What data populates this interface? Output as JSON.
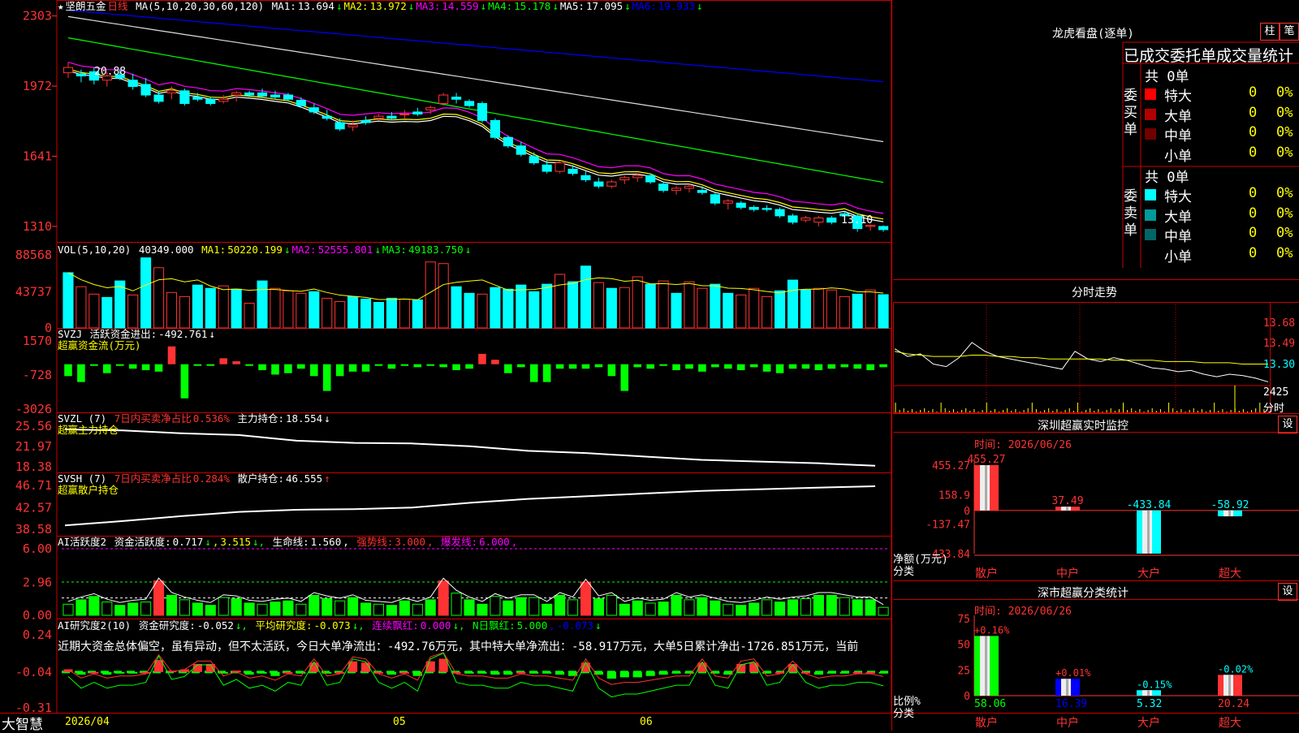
{
  "stock_name": "坚朗五金",
  "period": "日线",
  "app_name": "大智慧",
  "price_header": {
    "params": "MA(5,10,20,30,60,120)",
    "items": [
      {
        "label": "MA1:",
        "value": "13.694",
        "arrow": "↓",
        "color": "#ffffff"
      },
      {
        "label": "MA2:",
        "value": "13.972",
        "arrow": "↓",
        "color": "#ffff00"
      },
      {
        "label": "MA3:",
        "value": "14.559",
        "arrow": "↓",
        "color": "#ff00ff"
      },
      {
        "label": "MA4:",
        "value": "15.178",
        "arrow": "↓",
        "color": "#00ff00"
      },
      {
        "label": "MA5:",
        "value": "17.095",
        "arrow": "↓",
        "color": "#ffffff"
      },
      {
        "label": "MA6:",
        "value": "19.933",
        "arrow": "↓",
        "color": "#0000ff"
      }
    ]
  },
  "vol_header": {
    "params": "VOL(5,10,20)",
    "value": "40349.000",
    "items": [
      {
        "label": "MA1:",
        "value": "50220.199",
        "arrow": "↓",
        "color": "#ffff00"
      },
      {
        "label": "MA2:",
        "value": "52555.801",
        "arrow": "↓",
        "color": "#ff00ff"
      },
      {
        "label": "MA3:",
        "value": "49183.750",
        "arrow": "↓",
        "color": "#00ff00"
      }
    ]
  },
  "svzj_header": {
    "name": "SVZJ",
    "label": "活跃资金进出:",
    "value": "-492.761",
    "arrow": "↓",
    "sub": "超赢资金流(万元)"
  },
  "svzl_header": {
    "name": "SVZL (7)",
    "label1": "7日内买卖净占比",
    "value1": "0.536%",
    "label2": "主力持仓:",
    "value2": "18.554",
    "arrow": "↓",
    "sub": "超赢主力持仓"
  },
  "svsh_header": {
    "name": "SVSH (7)",
    "label1": "7日内买卖净占比",
    "value1": "0.284%",
    "label2": "散户持仓:",
    "value2": "46.555",
    "arrow": "↑",
    "sub": "超赢散户持仓"
  },
  "ai1_header": {
    "name": "AI活跃度2",
    "label": "资金活跃度:",
    "value": "0.717",
    "arrow": "↓",
    "value2": "3.515",
    "life_label": "生命线:",
    "life": "1.560",
    "strong_label": "强势线:",
    "strong": "3.000",
    "burst_label": "爆发线:",
    "burst": "6.000"
  },
  "ai2_header": {
    "name": "AI研究度2(10)",
    "label": "资金研究度:",
    "value": "-0.052",
    "label2": "平均研究度:",
    "value2": "-0.073",
    "label3": "连续飘红:",
    "value3": "0.000",
    "label4": "N日飘红:",
    "value4": "5.000",
    "value5": "-0.073"
  },
  "narrative": "近期大资金总体偏空，虽有异动，但不太活跃，今日大单净流出：-492.76万元，其中特大单净流出：-58.917万元，大单5日累计净出-1726.851万元，当前",
  "date_labels": [
    "2026/04",
    "05",
    "06"
  ],
  "right_panel": {
    "lhb_title": "龙虎看盘(逐单)",
    "btn_zhu": "柱",
    "btn_bi": "笔",
    "stats_title": "已成交委托单成交量统计",
    "buy_side": "委买单",
    "sell_side": "委卖单",
    "buy_total": "共 0单",
    "sell_total": "共 0单",
    "buy_rows": [
      {
        "label": "特大",
        "count": "0",
        "pct": "0%",
        "color": "#ff0000"
      },
      {
        "label": "大单",
        "count": "0",
        "pct": "0%",
        "color": "#b00000"
      },
      {
        "label": "中单",
        "count": "0",
        "pct": "0%",
        "color": "#700000"
      },
      {
        "label": "小单",
        "count": "0",
        "pct": "0%",
        "color": "#000000"
      }
    ],
    "sell_rows": [
      {
        "label": "特大",
        "count": "0",
        "pct": "0%",
        "color": "#00ffff"
      },
      {
        "label": "大单",
        "count": "0",
        "pct": "0%",
        "color": "#009999"
      },
      {
        "label": "中单",
        "count": "0",
        "pct": "0%",
        "color": "#006666"
      },
      {
        "label": "小单",
        "count": "0",
        "pct": "0%",
        "color": "#000000"
      }
    ],
    "intraday_title": "分时走势",
    "intraday_axis": [
      "13.68",
      "13.49",
      "13.30",
      "2425",
      "分时"
    ],
    "sz_monitor_title": "深圳超赢实时监控",
    "sz_class_title": "深市超赢分类统计",
    "btn_set": "设",
    "date_label": "时间: 2026/06/26",
    "net_label1": "净额(万元)",
    "net_label2": "分类",
    "ratio_label1": "比例%",
    "ratio_label2": "分类",
    "categories": [
      "散户",
      "中户",
      "大户",
      "超大"
    ]
  },
  "chart_data": [
    {
      "type": "candlestick",
      "title": "坚朗五金 日线",
      "y_ticks": [
        "2303",
        "1972",
        "1641",
        "1310"
      ],
      "price_tick_values": [
        23.03,
        19.72,
        16.41,
        13.1
      ],
      "ylim": [
        12.6,
        23.4
      ],
      "annotations": [
        {
          "text": "20.88"
        },
        {
          "text": "13.10"
        }
      ],
      "ohlc": [
        [
          20.35,
          20.85,
          20.1,
          20.6
        ],
        [
          20.3,
          20.5,
          19.9,
          20.2
        ],
        [
          20.4,
          20.6,
          19.8,
          20.0
        ],
        [
          20.0,
          20.4,
          19.7,
          20.2
        ],
        [
          20.25,
          20.5,
          20.0,
          20.1
        ],
        [
          20.0,
          20.3,
          19.55,
          19.7
        ],
        [
          19.8,
          20.1,
          19.2,
          19.3
        ],
        [
          19.3,
          19.5,
          18.9,
          19.0
        ],
        [
          19.4,
          19.7,
          19.1,
          19.5
        ],
        [
          19.5,
          19.6,
          18.8,
          18.9
        ],
        [
          19.2,
          19.4,
          19.0,
          19.1
        ],
        [
          19.1,
          19.2,
          18.8,
          18.9
        ],
        [
          19.0,
          19.3,
          18.9,
          19.1
        ],
        [
          19.3,
          19.5,
          19.0,
          19.4
        ],
        [
          19.4,
          19.5,
          19.2,
          19.3
        ],
        [
          19.4,
          19.6,
          19.2,
          19.25
        ],
        [
          19.3,
          19.5,
          19.1,
          19.2
        ],
        [
          19.3,
          19.4,
          19.0,
          19.1
        ],
        [
          19.05,
          19.2,
          18.7,
          18.8
        ],
        [
          18.7,
          18.9,
          18.4,
          18.5
        ],
        [
          18.3,
          18.6,
          18.1,
          18.2
        ],
        [
          18.0,
          18.2,
          17.6,
          17.7
        ],
        [
          17.8,
          18.1,
          17.6,
          17.9
        ],
        [
          18.1,
          18.3,
          17.9,
          18.0
        ],
        [
          18.2,
          18.4,
          18.1,
          18.3
        ],
        [
          18.3,
          18.5,
          18.1,
          18.2
        ],
        [
          18.4,
          18.6,
          18.2,
          18.4
        ],
        [
          18.5,
          18.7,
          18.3,
          18.4
        ],
        [
          18.6,
          18.8,
          18.4,
          18.7
        ],
        [
          18.9,
          19.4,
          18.8,
          19.3
        ],
        [
          19.2,
          19.4,
          18.9,
          19.1
        ],
        [
          19.0,
          19.1,
          18.7,
          18.8
        ],
        [
          18.9,
          19.0,
          18.0,
          18.1
        ],
        [
          18.1,
          18.2,
          17.2,
          17.3
        ],
        [
          17.3,
          17.4,
          16.8,
          16.9
        ],
        [
          16.9,
          17.1,
          16.4,
          16.5
        ],
        [
          16.4,
          16.6,
          16.0,
          16.1
        ],
        [
          16.0,
          16.2,
          15.6,
          15.7
        ],
        [
          15.7,
          16.2,
          15.6,
          16.1
        ],
        [
          15.8,
          16.0,
          15.5,
          15.6
        ],
        [
          15.5,
          15.7,
          15.2,
          15.3
        ],
        [
          15.2,
          15.4,
          14.9,
          15.0
        ],
        [
          15.0,
          15.3,
          14.9,
          15.2
        ],
        [
          15.3,
          15.5,
          15.1,
          15.4
        ],
        [
          15.4,
          15.6,
          15.2,
          15.5
        ],
        [
          15.5,
          15.6,
          15.1,
          15.2
        ],
        [
          15.1,
          15.2,
          14.7,
          14.8
        ],
        [
          14.8,
          15.0,
          14.6,
          14.9
        ],
        [
          14.9,
          15.1,
          14.7,
          15.0
        ],
        [
          14.8,
          15.0,
          14.6,
          14.7
        ],
        [
          14.6,
          14.7,
          14.1,
          14.2
        ],
        [
          14.2,
          14.4,
          13.9,
          14.3
        ],
        [
          14.2,
          14.3,
          13.9,
          14.0
        ],
        [
          14.0,
          14.1,
          13.8,
          13.9
        ],
        [
          13.95,
          14.1,
          13.8,
          13.9
        ],
        [
          13.9,
          14.0,
          13.5,
          13.6
        ],
        [
          13.6,
          13.7,
          13.2,
          13.3
        ],
        [
          13.4,
          13.6,
          13.3,
          13.5
        ],
        [
          13.3,
          13.6,
          13.1,
          13.5
        ],
        [
          13.5,
          13.6,
          13.2,
          13.3
        ],
        [
          13.7,
          13.8,
          13.5,
          13.6
        ],
        [
          13.6,
          13.7,
          12.85,
          13.0
        ],
        [
          13.1,
          13.2,
          12.9,
          13.15
        ],
        [
          13.1,
          13.15,
          12.85,
          12.95
        ]
      ],
      "ma_series": [
        {
          "name": "MA1",
          "start": 20.4,
          "end": 13.69,
          "color": "#ffffff"
        },
        {
          "name": "MA2",
          "start": 20.6,
          "end": 13.97,
          "color": "#ffff00"
        },
        {
          "name": "MA3",
          "start": 21.3,
          "end": 14.56,
          "color": "#ff00ff"
        },
        {
          "name": "MA4",
          "start": 22.0,
          "end": 15.18,
          "color": "#00ff00"
        },
        {
          "name": "MA5",
          "start": 23.0,
          "end": 17.1,
          "color": "#dddddd"
        },
        {
          "name": "MA6",
          "start": 23.3,
          "end": 19.93,
          "color": "#0000ff"
        }
      ]
    },
    {
      "type": "bar",
      "title": "VOL",
      "y_ticks": [
        "88568",
        "43737",
        "0"
      ],
      "ylim": [
        0,
        88568
      ],
      "values": [
        67000,
        50000,
        41000,
        37000,
        57000,
        40000,
        85000,
        73000,
        43000,
        38000,
        52000,
        48000,
        51000,
        47000,
        30000,
        57000,
        48000,
        45000,
        42000,
        44000,
        36000,
        32000,
        38000,
        35000,
        31000,
        36000,
        35000,
        34000,
        80000,
        78000,
        50000,
        42000,
        41000,
        49000,
        47000,
        52000,
        44000,
        53000,
        65000,
        56000,
        75000,
        55000,
        48000,
        49000,
        62000,
        53000,
        57000,
        42000,
        56000,
        48000,
        53000,
        42000,
        40000,
        48000,
        38000,
        45000,
        58000,
        46000,
        48000,
        46000,
        38000,
        41000,
        46000,
        40349
      ],
      "up_down": [
        "d",
        "u",
        "u",
        "d",
        "d",
        "u",
        "d",
        "u",
        "u",
        "u",
        "d",
        "d",
        "u",
        "d",
        "u",
        "d",
        "u",
        "u",
        "u",
        "d",
        "u",
        "u",
        "d",
        "d",
        "d",
        "d",
        "u",
        "d",
        "u",
        "u",
        "d",
        "d",
        "u",
        "d",
        "d",
        "d",
        "d",
        "d",
        "u",
        "d",
        "d",
        "u",
        "d",
        "u",
        "u",
        "d",
        "u",
        "d",
        "u",
        "u",
        "d",
        "d",
        "u",
        "u",
        "u",
        "d",
        "d",
        "d",
        "u",
        "u",
        "u",
        "d",
        "u",
        "d"
      ]
    },
    {
      "type": "bar",
      "title": "SVZJ 超赢资金流(万元)",
      "y_ticks": [
        "1570",
        "-728",
        "-3026"
      ],
      "ylim": [
        -3026,
        1570
      ],
      "values": [
        -800,
        -1200,
        -50,
        -600,
        -100,
        -300,
        -400,
        -500,
        1200,
        -2300,
        -100,
        -100,
        400,
        200,
        -50,
        -400,
        -700,
        -600,
        -300,
        -800,
        -1800,
        -800,
        -500,
        -500,
        -100,
        -300,
        -100,
        -200,
        -100,
        -200,
        -400,
        -300,
        700,
        300,
        -600,
        -200,
        -1200,
        -1200,
        -300,
        -300,
        -300,
        -200,
        -800,
        -1800,
        -200,
        -300,
        -100,
        -400,
        -300,
        -500,
        -200,
        -300,
        -400,
        -200,
        -500,
        -600,
        -300,
        -300,
        -400,
        -300,
        -200,
        -300,
        -400,
        -200,
        -300,
        -500,
        -500,
        -492
      ]
    },
    {
      "type": "line",
      "title": "SVZL 超赢主力持仓",
      "y_ticks": [
        "25.56",
        "21.97",
        "18.38"
      ],
      "ylim": [
        18.38,
        25.56
      ],
      "values": [
        25.0,
        24.8,
        24.3,
        24.0,
        23.0,
        22.6,
        22.5,
        22.0,
        21.2,
        20.8,
        20.2,
        19.6,
        19.3,
        19.0,
        18.554
      ]
    },
    {
      "type": "line",
      "title": "SVSH 超赢散户持仓",
      "y_ticks": [
        "46.71",
        "42.57",
        "38.58"
      ],
      "ylim": [
        38.58,
        46.71
      ],
      "values": [
        39.3,
        40.1,
        41.0,
        41.8,
        42.2,
        42.3,
        42.6,
        43.5,
        44.2,
        44.7,
        45.2,
        45.7,
        46.0,
        46.3,
        46.555
      ]
    },
    {
      "type": "bar",
      "title": "AI活跃度2",
      "y_ticks": [
        "6.00",
        "2.96",
        "0.00"
      ],
      "ylim": [
        0,
        6.0
      ],
      "values": [
        1.0,
        1.4,
        1.7,
        1.2,
        0.9,
        1.1,
        1.2,
        3.1,
        1.8,
        1.4,
        1.1,
        0.9,
        1.6,
        1.5,
        1.1,
        1.0,
        1.2,
        1.3,
        1.0,
        1.8,
        1.5,
        1.3,
        1.6,
        1.1,
        1.0,
        0.9,
        1.3,
        1.0,
        1.4,
        3.1,
        2.0,
        1.4,
        1.0,
        1.7,
        1.3,
        1.6,
        1.6,
        1.0,
        1.8,
        1.4,
        3.0,
        1.5,
        1.8,
        1.0,
        1.3,
        1.1,
        1.2,
        1.8,
        1.4,
        1.6,
        1.3,
        1.0,
        0.9,
        1.1,
        1.4,
        1.2,
        1.4,
        1.5,
        1.8,
        1.8,
        1.6,
        1.4,
        1.4,
        0.717
      ],
      "reference_lines": [
        {
          "value": 3.0,
          "color": "#00ff00"
        },
        {
          "value": 6.0,
          "color": "#ff00ff"
        },
        {
          "value": 1.56,
          "color": "#ffffff"
        }
      ]
    },
    {
      "type": "bar",
      "title": "AI研究度2",
      "y_ticks": [
        "0.24",
        "-0.04",
        "-0.31"
      ],
      "ylim": [
        -0.31,
        0.24
      ],
      "values": [
        -0.02,
        -0.06,
        -0.04,
        -0.06,
        -0.05,
        -0.05,
        -0.04,
        0.05,
        -0.03,
        -0.02,
        0.02,
        0.02,
        -0.05,
        -0.03,
        -0.06,
        -0.05,
        -0.07,
        -0.04,
        -0.05,
        0.03,
        -0.05,
        -0.04,
        0.04,
        0.03,
        -0.04,
        -0.06,
        -0.04,
        -0.07,
        0.04,
        0.06,
        -0.04,
        -0.05,
        -0.05,
        -0.06,
        -0.06,
        -0.04,
        -0.05,
        -0.05,
        -0.06,
        -0.07,
        0.03,
        -0.06,
        -0.09,
        -0.08,
        -0.08,
        -0.07,
        -0.06,
        -0.05,
        -0.05,
        0.03,
        -0.05,
        -0.06,
        0.02,
        0.03,
        -0.05,
        -0.04,
        0.02,
        -0.04,
        -0.06,
        -0.05,
        -0.05,
        -0.04,
        -0.04,
        -0.052
      ]
    },
    {
      "type": "line",
      "title": "分时走势",
      "y_ticks": [
        "13.68",
        "13.49",
        "13.30"
      ],
      "ylim": [
        13.15,
        13.75
      ],
      "values": [
        13.42,
        13.36,
        13.38,
        13.3,
        13.28,
        13.35,
        13.47,
        13.4,
        13.36,
        13.34,
        13.32,
        13.3,
        13.28,
        13.26,
        13.4,
        13.34,
        13.32,
        13.35,
        13.33,
        13.3,
        13.27,
        13.26,
        13.24,
        13.25,
        13.22,
        13.2,
        13.22,
        13.21,
        13.19,
        13.16
      ],
      "avg": [
        13.4,
        13.38,
        13.37,
        13.36,
        13.36,
        13.36,
        13.37,
        13.37,
        13.36,
        13.36,
        13.35,
        13.35,
        13.34,
        13.34,
        13.34,
        13.34,
        13.34,
        13.33,
        13.33,
        13.33,
        13.33,
        13.32,
        13.32,
        13.32,
        13.31,
        13.31,
        13.31,
        13.3,
        13.3,
        13.3
      ]
    },
    {
      "type": "bar",
      "title": "深圳超赢实时监控",
      "categories": [
        "散户",
        "中户",
        "大户",
        "超大"
      ],
      "values": [
        455.27,
        37.49,
        -433.84,
        -58.92
      ],
      "labels": [
        "455.27",
        "37.49",
        "-433.84",
        "-58.92"
      ],
      "y_ticks": [
        "455.27",
        "158.9",
        "0",
        "-137.47",
        "-433.84"
      ],
      "ylim": [
        -433.84,
        455.27
      ]
    },
    {
      "type": "bar",
      "title": "深市超赢分类统计",
      "categories": [
        "散户",
        "中户",
        "大户",
        "超大"
      ],
      "values": [
        58.06,
        16.39,
        5.32,
        20.24
      ],
      "value_labels": [
        "58.06",
        "16.39",
        "5.32",
        "20.24"
      ],
      "delta_labels": [
        "+0.16%",
        "+0.01%",
        "-0.15%",
        "-0.02%"
      ],
      "y_ticks": [
        "75",
        "50",
        "25",
        "0"
      ],
      "ylim": [
        0,
        75
      ]
    }
  ]
}
